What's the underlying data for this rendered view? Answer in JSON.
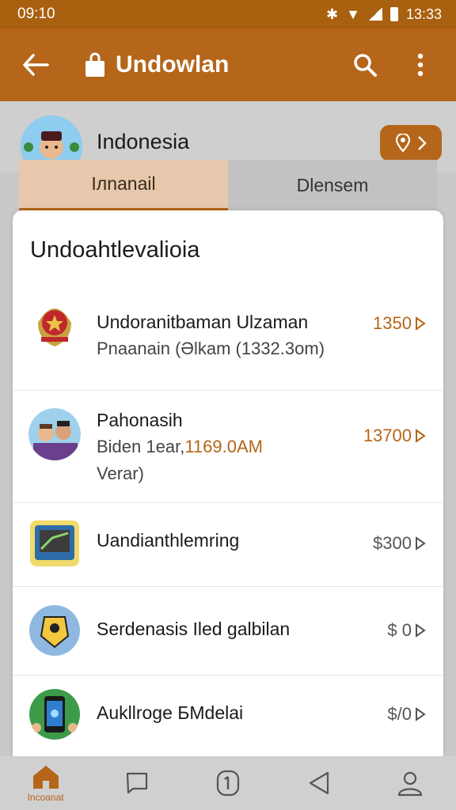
{
  "status": {
    "left_time": "09:10",
    "right_time": "13:33"
  },
  "appbar": {
    "title": "Undowlan"
  },
  "profile": {
    "country": "Indonesia"
  },
  "tabs": [
    {
      "label": "Iлnanail",
      "active": true
    },
    {
      "label": "Dlensem",
      "active": false
    }
  ],
  "card": {
    "title": "Undoahtlevalioia",
    "items": [
      {
        "title": "Undoranitbaman Ulzaman",
        "subtitle": "Pnaanain (Əlkam (1332.3om)",
        "price": "1350"
      },
      {
        "title": "Pahonasih",
        "subtitle": "Biden 1ear,",
        "subtitle_extra": "1169.0AM",
        "subtitle2": "Verar)",
        "price": "13700"
      },
      {
        "title": "Uandianthlemring",
        "price": "$300"
      },
      {
        "title": "Serdenasis Iled galbilan",
        "price": "$ 0"
      },
      {
        "title": "Aukllroge БMdelai",
        "price": "$/0"
      }
    ]
  },
  "bottomnav": {
    "home_label": "Incoanat"
  },
  "colors": {
    "accent": "#b5661a",
    "statusbar": "#a9600f"
  }
}
